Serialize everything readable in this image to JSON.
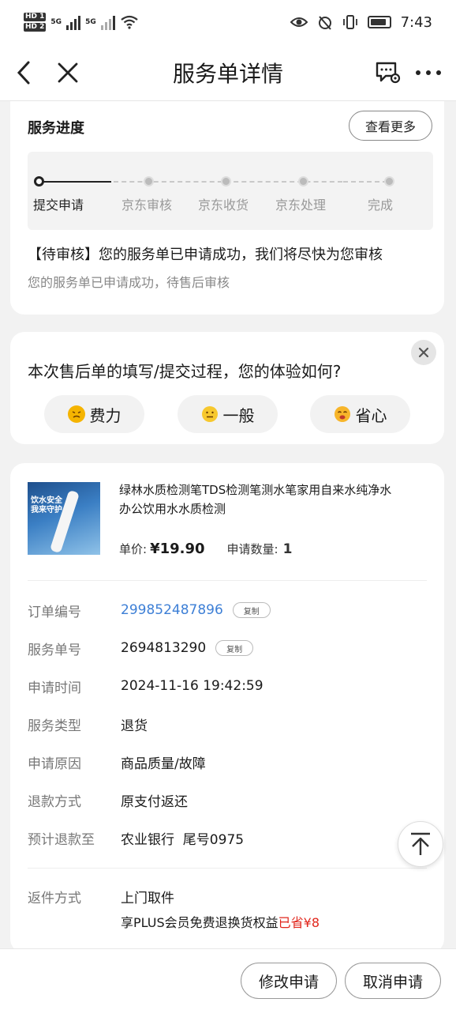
{
  "status_bar": {
    "hd1": "HD 1",
    "hd2": "HD 2",
    "net1": "5G",
    "net2": "5G",
    "time": "7:43"
  },
  "nav": {
    "title": "服务单详情"
  },
  "progress": {
    "title": "服务进度",
    "more_label": "查看更多",
    "steps": [
      {
        "label": "提交申请",
        "active": true
      },
      {
        "label": "京东审核",
        "active": false
      },
      {
        "label": "京东收货",
        "active": false
      },
      {
        "label": "京东处理",
        "active": false
      },
      {
        "label": "完成",
        "active": false
      }
    ],
    "status_main": "【待审核】您的服务单已申请成功，我们将尽快为您审核",
    "status_sub": "您的服务单已申请成功，待售后审核"
  },
  "survey": {
    "question": "本次售后单的填写/提交过程，您的体验如何?",
    "options": [
      {
        "label": "费力",
        "icon": "frustrated-face-icon",
        "color": "#f5b400"
      },
      {
        "label": "一般",
        "icon": "neutral-face-icon",
        "color": "#f7c82e"
      },
      {
        "label": "省心",
        "icon": "relieved-face-icon",
        "color": "#f7b52a"
      }
    ]
  },
  "product": {
    "name": "绿林水质检测笔TDS检测笔测水笔家用自来水纯净水办公饮用水水质检测",
    "image_text": "饮水安全 我来守护",
    "price_label": "单价:",
    "price": "¥19.90",
    "qty_label": "申请数量:",
    "qty": "1"
  },
  "details": {
    "order_no_label": "订单编号",
    "order_no": "299852487896",
    "service_no_label": "服务单号",
    "service_no": "2694813290",
    "copy_label": "复制",
    "apply_time_label": "申请时间",
    "apply_time": "2024-11-16 19:42:59",
    "service_type_label": "服务类型",
    "service_type": "退货",
    "reason_label": "申请原因",
    "reason": "商品质量/故障",
    "refund_method_label": "退款方式",
    "refund_method": "原支付返还",
    "refund_to_label": "预计退款至",
    "refund_to": "农业银行  尾号0975",
    "return_method_label": "返件方式",
    "return_method": "上门取件",
    "plus_note": "享PLUS会员免费退换货权益",
    "plus_saved": "已省¥8"
  },
  "actions": {
    "modify_label": "修改申请",
    "cancel_label": "取消申请"
  },
  "colors": {
    "link": "#3d7fd6",
    "saved": "#e1251b"
  }
}
